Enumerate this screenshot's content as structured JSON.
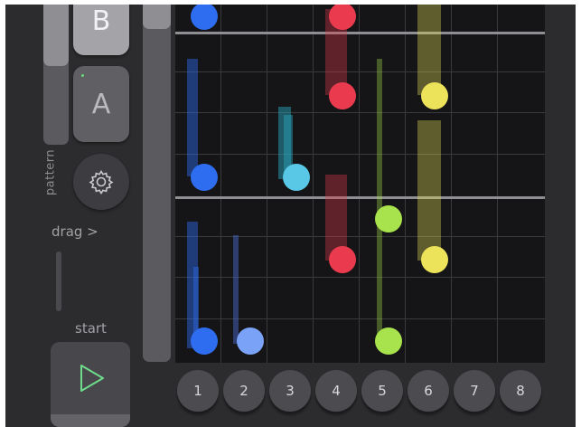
{
  "controls": {
    "b_label": "B",
    "a_label": "A",
    "pattern_label": "pattern",
    "drag_label": "drag >",
    "start_label": "start"
  },
  "column_buttons": [
    "1",
    "2",
    "3",
    "4",
    "5",
    "6",
    "7",
    "8"
  ],
  "sequencer": {
    "colors": {
      "blue": "#2f6df0",
      "light_blue": "#7aa2f7",
      "cyan": "#58c8e6",
      "red": "#ea3b4e",
      "green": "#a8e34d",
      "yellow": "#ece35a"
    },
    "notes": [
      {
        "column": 1,
        "color": "blue"
      },
      {
        "column": 1,
        "color": "blue"
      },
      {
        "column": 1,
        "color": "blue"
      },
      {
        "column": 2,
        "color": "light_blue"
      },
      {
        "column": 3,
        "color": "cyan"
      },
      {
        "column": 4,
        "color": "red"
      },
      {
        "column": 4,
        "color": "red"
      },
      {
        "column": 4,
        "color": "red"
      },
      {
        "column": 5,
        "color": "green"
      },
      {
        "column": 5,
        "color": "green"
      },
      {
        "column": 6,
        "color": "yellow"
      },
      {
        "column": 6,
        "color": "yellow"
      }
    ]
  }
}
